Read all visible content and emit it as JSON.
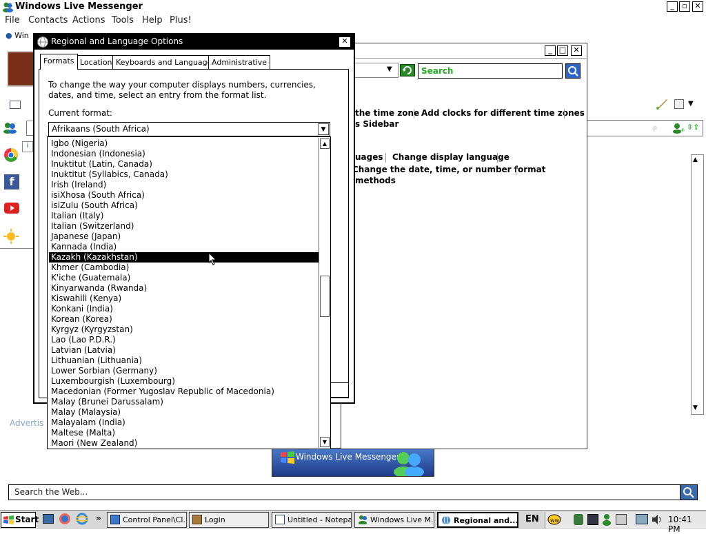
{
  "messenger": {
    "title": "Windows Live Messenger",
    "menu": [
      "File",
      "Contacts",
      "Actions",
      "Tools",
      "Help",
      "Plus!"
    ],
    "win_label": "Win",
    "advert": "Advertis",
    "banner": "Windows Live Messenger",
    "web_search_placeholder": "Search the Web..."
  },
  "control_panel": {
    "search_placeholder": "Search",
    "links_row1": [
      "the time zone",
      "Add clocks for different time zones"
    ],
    "links_row1b": "s Sidebar",
    "links_row2": [
      "uages",
      "Change display language"
    ],
    "links_row3": "Change the date, time, or number format",
    "links_row4": "methods"
  },
  "dialog": {
    "title": "Regional and Language Options",
    "tabs": [
      "Formats",
      "Location",
      "Keyboards and Languages",
      "Administrative"
    ],
    "active_tab": "Formats",
    "intro": "To change the way your computer displays numbers, currencies, dates, and time, select an entry from the format list.",
    "current_format_label": "Current format:",
    "current_format_value": "Afrikaans (South Africa)",
    "selected_item": "Kazakh (Kazakhstan)",
    "list": [
      "Igbo (Nigeria)",
      "Indonesian (Indonesia)",
      "Inuktitut (Latin, Canada)",
      "Inuktitut (Syllabics, Canada)",
      "Irish (Ireland)",
      "isiXhosa (South Africa)",
      "isiZulu (South Africa)",
      "Italian (Italy)",
      "Italian (Switzerland)",
      "Japanese (Japan)",
      "Kannada (India)",
      "Kazakh (Kazakhstan)",
      "Khmer (Cambodia)",
      "K'iche (Guatemala)",
      "Kinyarwanda (Rwanda)",
      "Kiswahili (Kenya)",
      "Konkani (India)",
      "Korean (Korea)",
      "Kyrgyz (Kyrgyzstan)",
      "Lao (Lao P.D.R.)",
      "Latvian (Latvia)",
      "Lithuanian (Lithuania)",
      "Lower Sorbian (Germany)",
      "Luxembourgish (Luxembourg)",
      "Macedonian (Former Yugoslav Republic of Macedonia)",
      "Malay (Brunei Darussalam)",
      "Malay (Malaysia)",
      "Malayalam (India)",
      "Maltese (Malta)",
      "Maori (New Zealand)"
    ]
  },
  "taskbar": {
    "start": "Start",
    "items": [
      "Control Panel\\Cl...",
      "Login",
      "Untitled - Notepad",
      "Windows Live M...",
      "Regional and..."
    ],
    "active_item": "Regional and...",
    "language": "EN",
    "clock": "10:41 PM",
    "quick_launch_more": "»"
  },
  "colors": {
    "selection": "#000000",
    "search_green": "#22aa22",
    "messenger_blue": "#1e5aa8"
  }
}
